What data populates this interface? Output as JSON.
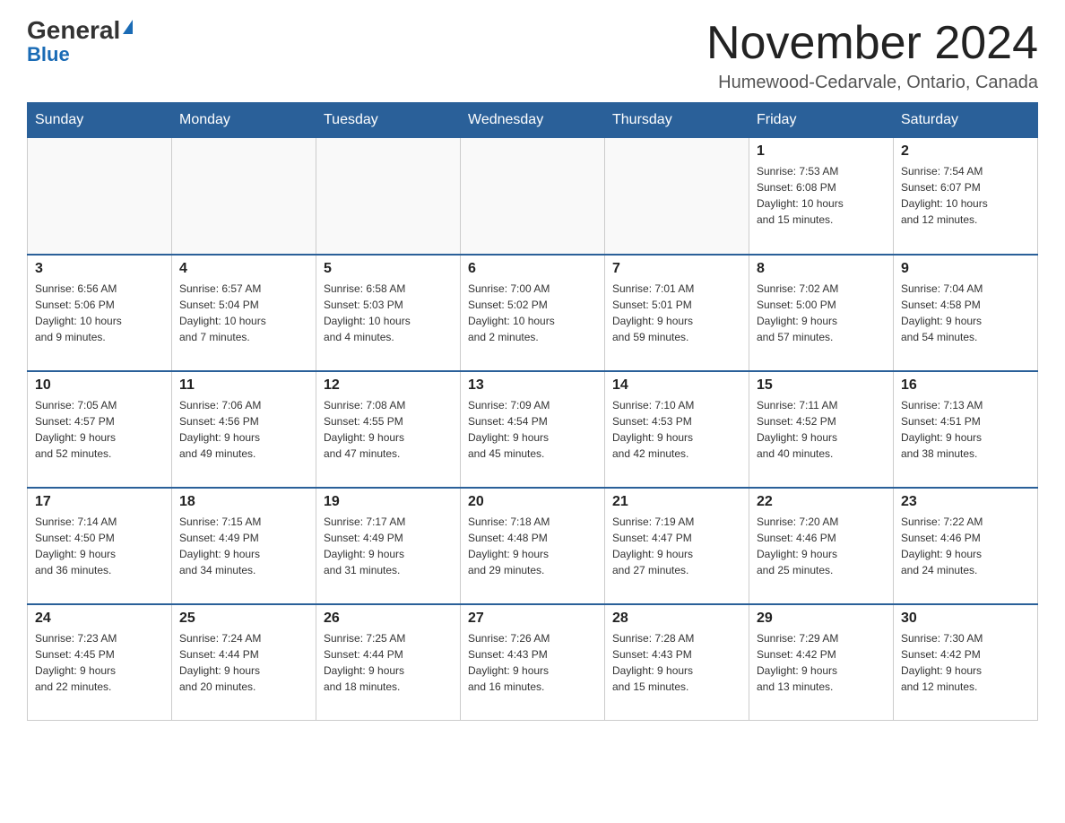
{
  "header": {
    "logo": {
      "general": "General",
      "blue": "Blue"
    },
    "title": "November 2024",
    "location": "Humewood-Cedarvale, Ontario, Canada"
  },
  "weekdays": [
    "Sunday",
    "Monday",
    "Tuesday",
    "Wednesday",
    "Thursday",
    "Friday",
    "Saturday"
  ],
  "weeks": [
    [
      {
        "day": "",
        "info": ""
      },
      {
        "day": "",
        "info": ""
      },
      {
        "day": "",
        "info": ""
      },
      {
        "day": "",
        "info": ""
      },
      {
        "day": "",
        "info": ""
      },
      {
        "day": "1",
        "info": "Sunrise: 7:53 AM\nSunset: 6:08 PM\nDaylight: 10 hours\nand 15 minutes."
      },
      {
        "day": "2",
        "info": "Sunrise: 7:54 AM\nSunset: 6:07 PM\nDaylight: 10 hours\nand 12 minutes."
      }
    ],
    [
      {
        "day": "3",
        "info": "Sunrise: 6:56 AM\nSunset: 5:06 PM\nDaylight: 10 hours\nand 9 minutes."
      },
      {
        "day": "4",
        "info": "Sunrise: 6:57 AM\nSunset: 5:04 PM\nDaylight: 10 hours\nand 7 minutes."
      },
      {
        "day": "5",
        "info": "Sunrise: 6:58 AM\nSunset: 5:03 PM\nDaylight: 10 hours\nand 4 minutes."
      },
      {
        "day": "6",
        "info": "Sunrise: 7:00 AM\nSunset: 5:02 PM\nDaylight: 10 hours\nand 2 minutes."
      },
      {
        "day": "7",
        "info": "Sunrise: 7:01 AM\nSunset: 5:01 PM\nDaylight: 9 hours\nand 59 minutes."
      },
      {
        "day": "8",
        "info": "Sunrise: 7:02 AM\nSunset: 5:00 PM\nDaylight: 9 hours\nand 57 minutes."
      },
      {
        "day": "9",
        "info": "Sunrise: 7:04 AM\nSunset: 4:58 PM\nDaylight: 9 hours\nand 54 minutes."
      }
    ],
    [
      {
        "day": "10",
        "info": "Sunrise: 7:05 AM\nSunset: 4:57 PM\nDaylight: 9 hours\nand 52 minutes."
      },
      {
        "day": "11",
        "info": "Sunrise: 7:06 AM\nSunset: 4:56 PM\nDaylight: 9 hours\nand 49 minutes."
      },
      {
        "day": "12",
        "info": "Sunrise: 7:08 AM\nSunset: 4:55 PM\nDaylight: 9 hours\nand 47 minutes."
      },
      {
        "day": "13",
        "info": "Sunrise: 7:09 AM\nSunset: 4:54 PM\nDaylight: 9 hours\nand 45 minutes."
      },
      {
        "day": "14",
        "info": "Sunrise: 7:10 AM\nSunset: 4:53 PM\nDaylight: 9 hours\nand 42 minutes."
      },
      {
        "day": "15",
        "info": "Sunrise: 7:11 AM\nSunset: 4:52 PM\nDaylight: 9 hours\nand 40 minutes."
      },
      {
        "day": "16",
        "info": "Sunrise: 7:13 AM\nSunset: 4:51 PM\nDaylight: 9 hours\nand 38 minutes."
      }
    ],
    [
      {
        "day": "17",
        "info": "Sunrise: 7:14 AM\nSunset: 4:50 PM\nDaylight: 9 hours\nand 36 minutes."
      },
      {
        "day": "18",
        "info": "Sunrise: 7:15 AM\nSunset: 4:49 PM\nDaylight: 9 hours\nand 34 minutes."
      },
      {
        "day": "19",
        "info": "Sunrise: 7:17 AM\nSunset: 4:49 PM\nDaylight: 9 hours\nand 31 minutes."
      },
      {
        "day": "20",
        "info": "Sunrise: 7:18 AM\nSunset: 4:48 PM\nDaylight: 9 hours\nand 29 minutes."
      },
      {
        "day": "21",
        "info": "Sunrise: 7:19 AM\nSunset: 4:47 PM\nDaylight: 9 hours\nand 27 minutes."
      },
      {
        "day": "22",
        "info": "Sunrise: 7:20 AM\nSunset: 4:46 PM\nDaylight: 9 hours\nand 25 minutes."
      },
      {
        "day": "23",
        "info": "Sunrise: 7:22 AM\nSunset: 4:46 PM\nDaylight: 9 hours\nand 24 minutes."
      }
    ],
    [
      {
        "day": "24",
        "info": "Sunrise: 7:23 AM\nSunset: 4:45 PM\nDaylight: 9 hours\nand 22 minutes."
      },
      {
        "day": "25",
        "info": "Sunrise: 7:24 AM\nSunset: 4:44 PM\nDaylight: 9 hours\nand 20 minutes."
      },
      {
        "day": "26",
        "info": "Sunrise: 7:25 AM\nSunset: 4:44 PM\nDaylight: 9 hours\nand 18 minutes."
      },
      {
        "day": "27",
        "info": "Sunrise: 7:26 AM\nSunset: 4:43 PM\nDaylight: 9 hours\nand 16 minutes."
      },
      {
        "day": "28",
        "info": "Sunrise: 7:28 AM\nSunset: 4:43 PM\nDaylight: 9 hours\nand 15 minutes."
      },
      {
        "day": "29",
        "info": "Sunrise: 7:29 AM\nSunset: 4:42 PM\nDaylight: 9 hours\nand 13 minutes."
      },
      {
        "day": "30",
        "info": "Sunrise: 7:30 AM\nSunset: 4:42 PM\nDaylight: 9 hours\nand 12 minutes."
      }
    ]
  ]
}
